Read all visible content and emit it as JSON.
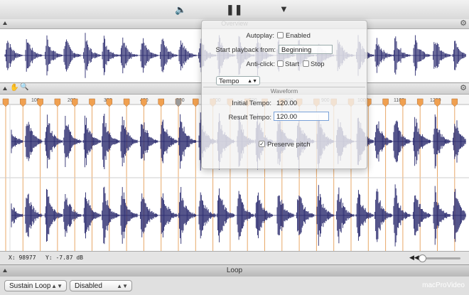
{
  "toolbar": {
    "icons": [
      "speaker-icon",
      "pause-icon",
      "marker-icon",
      "cursor-icon"
    ]
  },
  "overview": {
    "title": "Overview"
  },
  "inspector": {
    "autoplay_label": "Autoplay:",
    "autoplay_checkbox_label": "Enabled",
    "start_from_label": "Start playback from:",
    "start_from_value": "Beginning",
    "anticlick_label": "Anti-click:",
    "anticlick_start_label": "Start",
    "anticlick_stop_label": "Stop",
    "tempo_popup": "Tempo",
    "waveform_section": "Waveform",
    "initial_tempo_label": "Initial Tempo:",
    "initial_tempo_value": "120.00",
    "result_tempo_label": "Result Tempo:",
    "result_tempo_value": "120.00",
    "preserve_pitch_label": "Preserve pitch",
    "preserve_pitch_checked": true
  },
  "ruler": {
    "labels": [
      "100",
      "200",
      "300",
      "400",
      "500",
      "600",
      "700",
      "800",
      "900",
      "1000",
      "1100",
      "1200"
    ]
  },
  "status": {
    "x_readout": "X: 98977",
    "y_readout": "Y: -7.87 dB"
  },
  "loop": {
    "title": "Loop",
    "mode_value": "Sustain Loop",
    "state_value": "Disabled"
  },
  "branding": {
    "watermark": "macProVideo"
  },
  "colors": {
    "waveform": "#2a2a6e",
    "marker": "#f0a050",
    "marker_line": "#e8a868"
  }
}
